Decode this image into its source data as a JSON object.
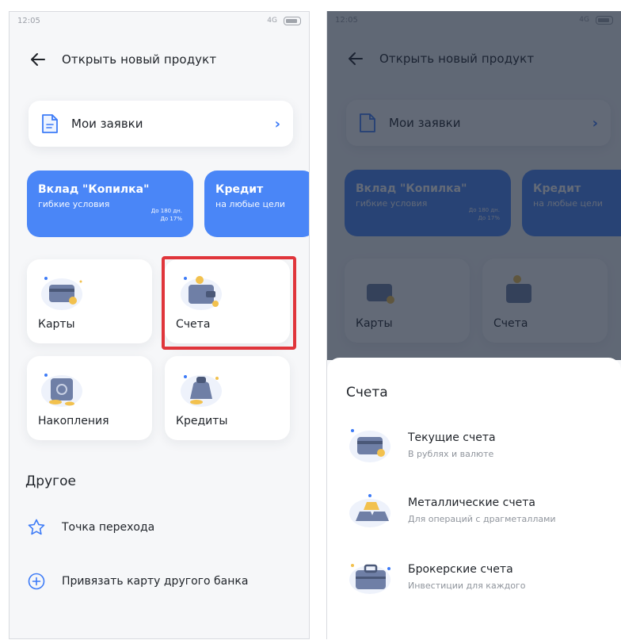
{
  "status": {
    "time": "12:05",
    "network": "4G"
  },
  "header": {
    "title": "Открыть новый продукт"
  },
  "requests": {
    "label": "Мои заявки"
  },
  "promos": [
    {
      "title": "Вклад \"Копилка\"",
      "subtitle": "гибкие условия",
      "note1": "До 180 дн.",
      "note2": "До 17%"
    },
    {
      "title": "Кредит",
      "subtitle": "на любые цели"
    }
  ],
  "tiles": [
    {
      "label": "Карты"
    },
    {
      "label": "Счета"
    },
    {
      "label": "Накопления"
    },
    {
      "label": "Кредиты"
    }
  ],
  "other": {
    "heading": "Другое",
    "items": [
      {
        "label": "Точка перехода"
      },
      {
        "label": "Привязать карту другого банка"
      }
    ]
  },
  "sheet": {
    "title": "Счета",
    "items": [
      {
        "title": "Текущие счета",
        "subtitle": "В рублях и валюте"
      },
      {
        "title": "Металлические счета",
        "subtitle": "Для операций с драгметаллами"
      },
      {
        "title": "Брокерские счета",
        "subtitle": "Инвестиции для каждого"
      }
    ]
  },
  "colors": {
    "accent": "#4a86f7",
    "highlight": "#e0353b",
    "overlay": "#19233a"
  }
}
